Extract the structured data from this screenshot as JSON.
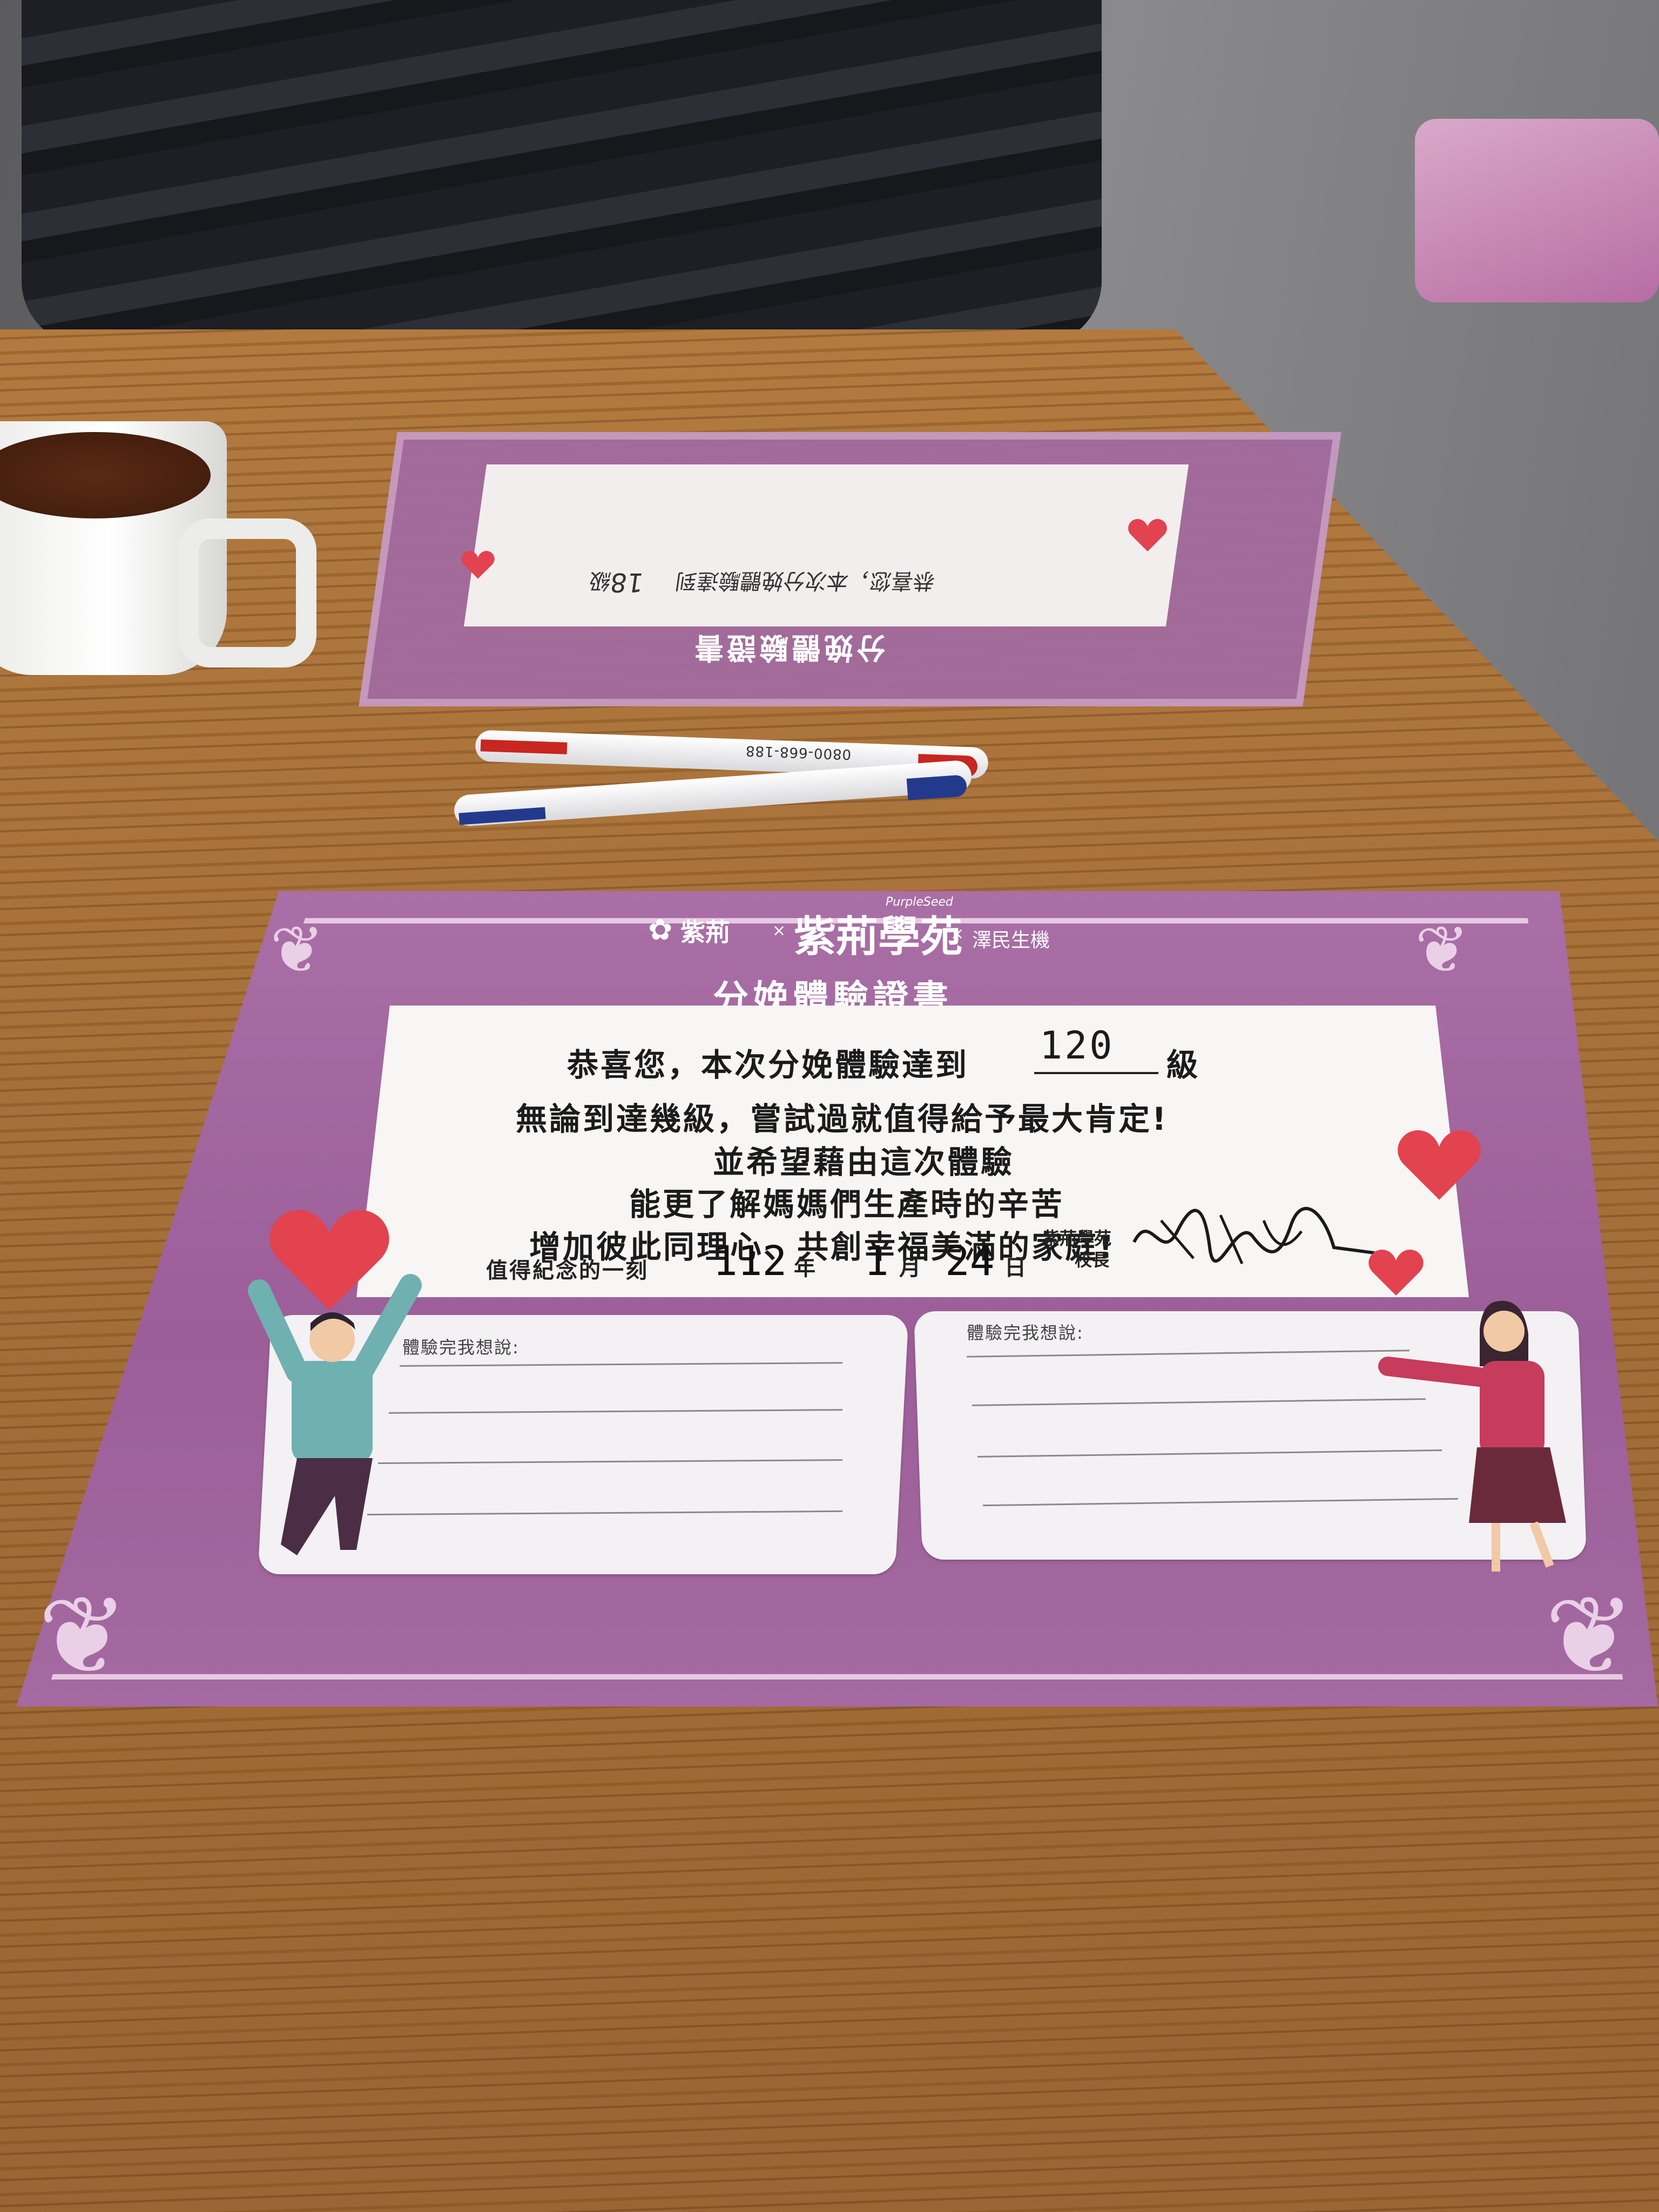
{
  "far_certificate": {
    "upside_down_fragments": [
      "分娩體驗證書",
      "恭喜您，本次分娩體驗達到",
      "18",
      "級"
    ]
  },
  "pen_print": "0800-668-188",
  "certificate": {
    "brand_left": "紫荊",
    "brand_center": "紫荊學苑",
    "brand_center_en": "PurpleSeed",
    "brand_right": "澤民生機",
    "separator": "×",
    "title": "分娩體驗證書",
    "line1_before": "恭喜您，本次分娩體驗達到",
    "level_handwritten": "120",
    "line1_after": "級",
    "line2": "無論到達幾級，嘗試過就值得給予最大肯定!",
    "line3": "並希望藉由這次體驗",
    "line4": "能更了解媽媽們生產時的辛苦",
    "line5": "增加彼此同理心、共創幸福美滿的家庭!",
    "memorial_label": "值得紀念的一刻",
    "year_handwritten": "112",
    "year_label": "年",
    "month_handwritten": "1",
    "month_label": "月",
    "day_handwritten": "24",
    "day_label": "日",
    "principal_org": "紫荊學苑",
    "principal_title": "校長",
    "box_left_label": "體驗完我想說:",
    "box_right_label": "體驗完我想說:"
  },
  "colors": {
    "certificate_purple": "#a96fa6",
    "heart_red": "#e2434f",
    "table_wood": "#a6703a"
  }
}
